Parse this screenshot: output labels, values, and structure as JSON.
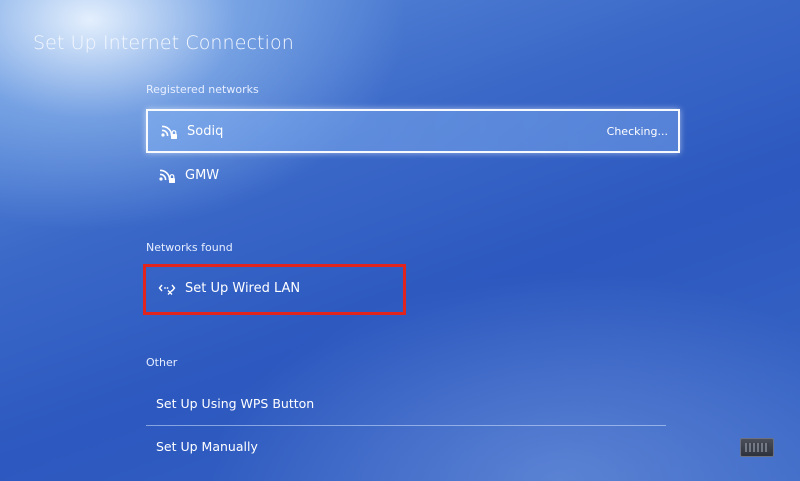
{
  "header": {
    "title": "Set Up Internet Connection"
  },
  "registered": {
    "label": "Registered networks",
    "networks": [
      {
        "name": "Sodiq",
        "status": "Checking...",
        "icon": "wifi-locked-icon",
        "selected": true
      },
      {
        "name": "GMW",
        "status": "",
        "icon": "wifi-locked-icon",
        "selected": false
      }
    ]
  },
  "found": {
    "label": "Networks found",
    "items": [
      {
        "name": "Set Up Wired LAN",
        "icon": "wired-lan-icon",
        "highlighted": true
      }
    ]
  },
  "other": {
    "label": "Other",
    "items": [
      {
        "name": "Set Up Using WPS Button"
      },
      {
        "name": "Set Up Manually"
      }
    ]
  },
  "colors": {
    "background": "#2c58bf",
    "highlight_box": "#e2241f",
    "selected_border": "#ffffff"
  }
}
